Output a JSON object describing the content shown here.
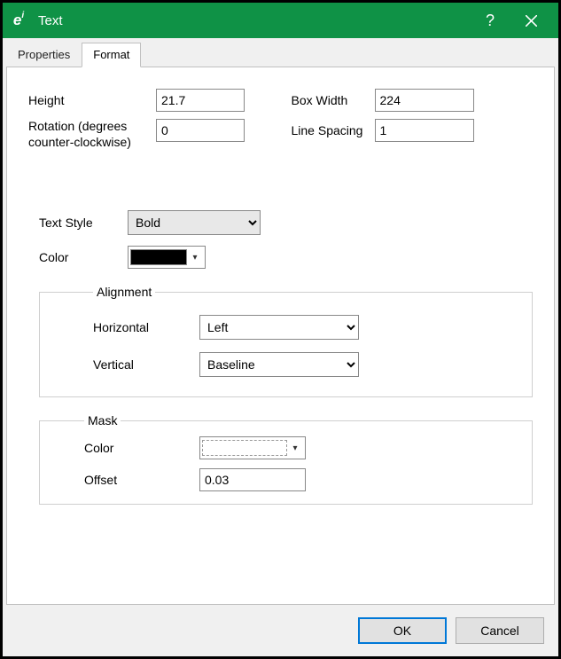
{
  "titlebar": {
    "title": "Text"
  },
  "tabs": {
    "properties": "Properties",
    "format": "Format"
  },
  "fields": {
    "height_label": "Height",
    "height_value": "21.7",
    "rotation_label": "Rotation (degrees counter-clockwise)",
    "rotation_value": "0",
    "box_width_label": "Box Width",
    "box_width_value": "224",
    "line_spacing_label": "Line Spacing",
    "line_spacing_value": "1",
    "text_style_label": "Text Style",
    "text_style_value": "Bold",
    "color_label": "Color",
    "color_value": "#000000"
  },
  "alignment": {
    "legend": "Alignment",
    "horizontal_label": "Horizontal",
    "horizontal_value": "Left",
    "vertical_label": "Vertical",
    "vertical_value": "Baseline"
  },
  "mask": {
    "legend": "Mask",
    "color_label": "Color",
    "color_value": "",
    "offset_label": "Offset",
    "offset_value": "0.03"
  },
  "buttons": {
    "ok": "OK",
    "cancel": "Cancel"
  }
}
